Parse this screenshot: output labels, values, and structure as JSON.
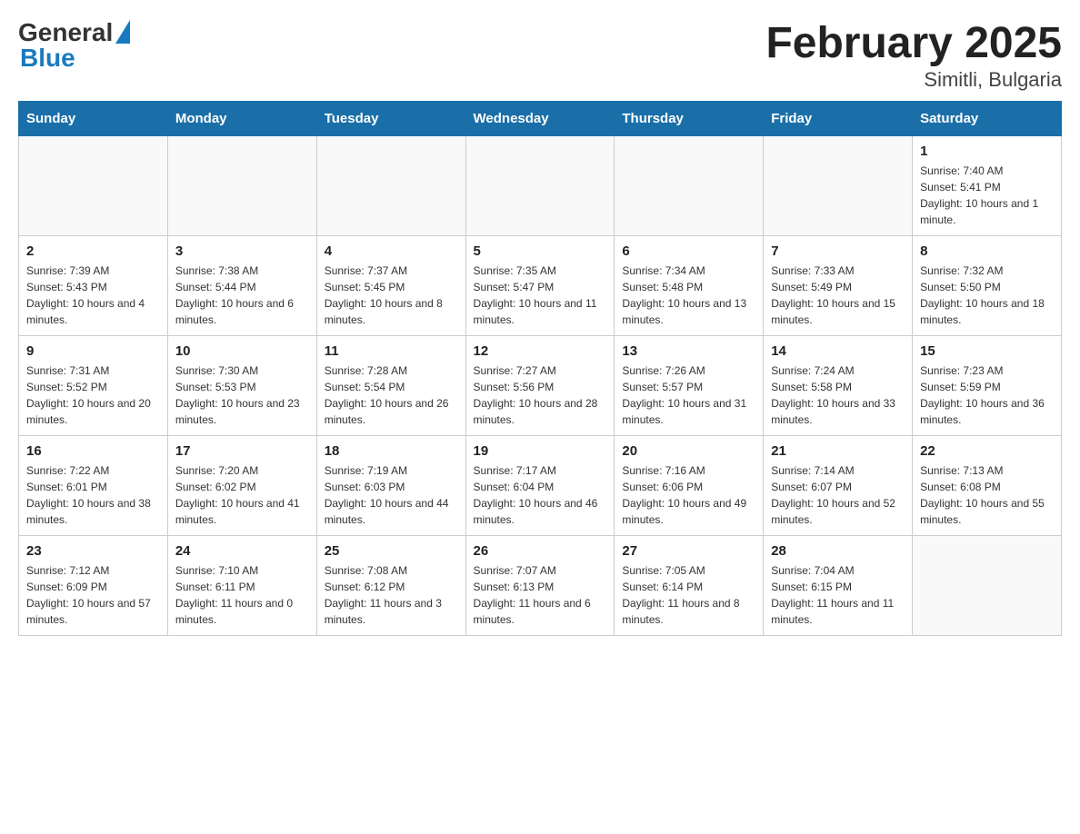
{
  "header": {
    "logo_general": "General",
    "logo_blue": "Blue",
    "title": "February 2025",
    "subtitle": "Simitli, Bulgaria"
  },
  "days_of_week": [
    "Sunday",
    "Monday",
    "Tuesday",
    "Wednesday",
    "Thursday",
    "Friday",
    "Saturday"
  ],
  "weeks": [
    [
      {
        "day": "",
        "info": ""
      },
      {
        "day": "",
        "info": ""
      },
      {
        "day": "",
        "info": ""
      },
      {
        "day": "",
        "info": ""
      },
      {
        "day": "",
        "info": ""
      },
      {
        "day": "",
        "info": ""
      },
      {
        "day": "1",
        "info": "Sunrise: 7:40 AM\nSunset: 5:41 PM\nDaylight: 10 hours and 1 minute."
      }
    ],
    [
      {
        "day": "2",
        "info": "Sunrise: 7:39 AM\nSunset: 5:43 PM\nDaylight: 10 hours and 4 minutes."
      },
      {
        "day": "3",
        "info": "Sunrise: 7:38 AM\nSunset: 5:44 PM\nDaylight: 10 hours and 6 minutes."
      },
      {
        "day": "4",
        "info": "Sunrise: 7:37 AM\nSunset: 5:45 PM\nDaylight: 10 hours and 8 minutes."
      },
      {
        "day": "5",
        "info": "Sunrise: 7:35 AM\nSunset: 5:47 PM\nDaylight: 10 hours and 11 minutes."
      },
      {
        "day": "6",
        "info": "Sunrise: 7:34 AM\nSunset: 5:48 PM\nDaylight: 10 hours and 13 minutes."
      },
      {
        "day": "7",
        "info": "Sunrise: 7:33 AM\nSunset: 5:49 PM\nDaylight: 10 hours and 15 minutes."
      },
      {
        "day": "8",
        "info": "Sunrise: 7:32 AM\nSunset: 5:50 PM\nDaylight: 10 hours and 18 minutes."
      }
    ],
    [
      {
        "day": "9",
        "info": "Sunrise: 7:31 AM\nSunset: 5:52 PM\nDaylight: 10 hours and 20 minutes."
      },
      {
        "day": "10",
        "info": "Sunrise: 7:30 AM\nSunset: 5:53 PM\nDaylight: 10 hours and 23 minutes."
      },
      {
        "day": "11",
        "info": "Sunrise: 7:28 AM\nSunset: 5:54 PM\nDaylight: 10 hours and 26 minutes."
      },
      {
        "day": "12",
        "info": "Sunrise: 7:27 AM\nSunset: 5:56 PM\nDaylight: 10 hours and 28 minutes."
      },
      {
        "day": "13",
        "info": "Sunrise: 7:26 AM\nSunset: 5:57 PM\nDaylight: 10 hours and 31 minutes."
      },
      {
        "day": "14",
        "info": "Sunrise: 7:24 AM\nSunset: 5:58 PM\nDaylight: 10 hours and 33 minutes."
      },
      {
        "day": "15",
        "info": "Sunrise: 7:23 AM\nSunset: 5:59 PM\nDaylight: 10 hours and 36 minutes."
      }
    ],
    [
      {
        "day": "16",
        "info": "Sunrise: 7:22 AM\nSunset: 6:01 PM\nDaylight: 10 hours and 38 minutes."
      },
      {
        "day": "17",
        "info": "Sunrise: 7:20 AM\nSunset: 6:02 PM\nDaylight: 10 hours and 41 minutes."
      },
      {
        "day": "18",
        "info": "Sunrise: 7:19 AM\nSunset: 6:03 PM\nDaylight: 10 hours and 44 minutes."
      },
      {
        "day": "19",
        "info": "Sunrise: 7:17 AM\nSunset: 6:04 PM\nDaylight: 10 hours and 46 minutes."
      },
      {
        "day": "20",
        "info": "Sunrise: 7:16 AM\nSunset: 6:06 PM\nDaylight: 10 hours and 49 minutes."
      },
      {
        "day": "21",
        "info": "Sunrise: 7:14 AM\nSunset: 6:07 PM\nDaylight: 10 hours and 52 minutes."
      },
      {
        "day": "22",
        "info": "Sunrise: 7:13 AM\nSunset: 6:08 PM\nDaylight: 10 hours and 55 minutes."
      }
    ],
    [
      {
        "day": "23",
        "info": "Sunrise: 7:12 AM\nSunset: 6:09 PM\nDaylight: 10 hours and 57 minutes."
      },
      {
        "day": "24",
        "info": "Sunrise: 7:10 AM\nSunset: 6:11 PM\nDaylight: 11 hours and 0 minutes."
      },
      {
        "day": "25",
        "info": "Sunrise: 7:08 AM\nSunset: 6:12 PM\nDaylight: 11 hours and 3 minutes."
      },
      {
        "day": "26",
        "info": "Sunrise: 7:07 AM\nSunset: 6:13 PM\nDaylight: 11 hours and 6 minutes."
      },
      {
        "day": "27",
        "info": "Sunrise: 7:05 AM\nSunset: 6:14 PM\nDaylight: 11 hours and 8 minutes."
      },
      {
        "day": "28",
        "info": "Sunrise: 7:04 AM\nSunset: 6:15 PM\nDaylight: 11 hours and 11 minutes."
      },
      {
        "day": "",
        "info": ""
      }
    ]
  ]
}
